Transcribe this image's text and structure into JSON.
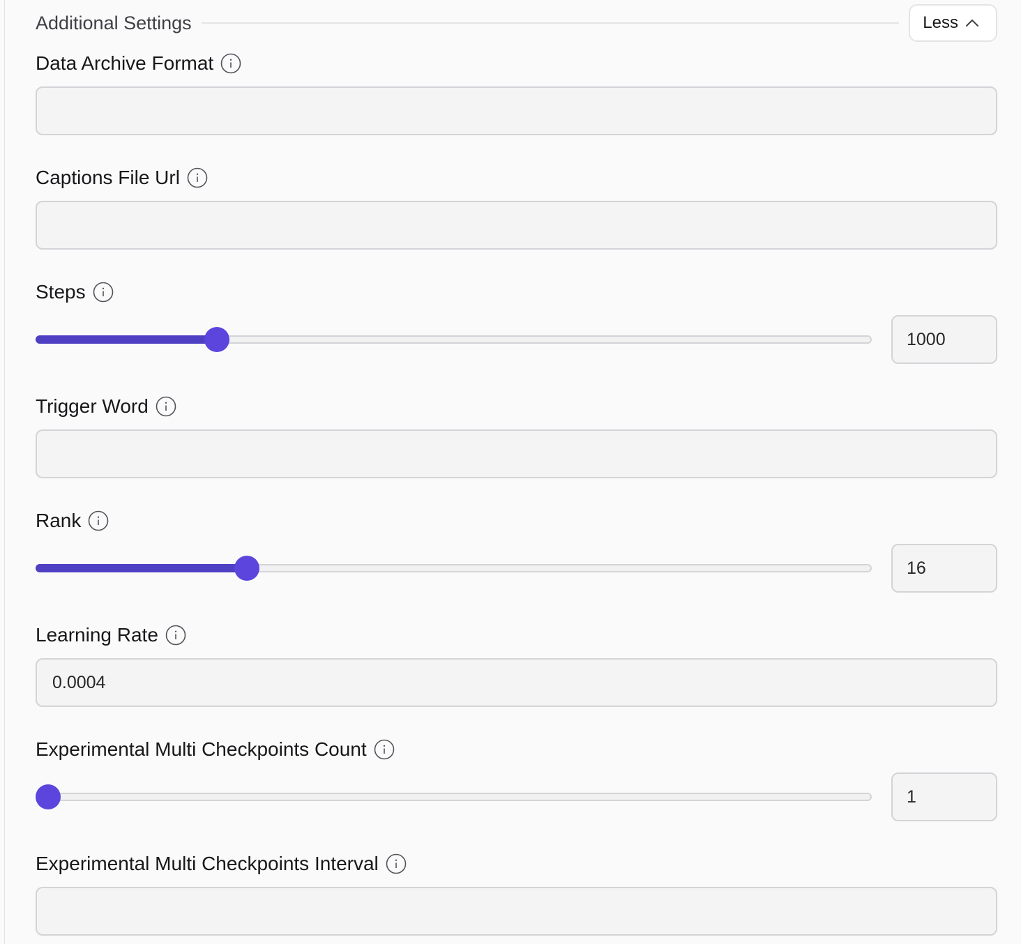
{
  "section": {
    "title": "Additional Settings",
    "toggle_label": "Less"
  },
  "fields": {
    "data_archive_format": {
      "label": "Data Archive Format",
      "value": ""
    },
    "captions_file_url": {
      "label": "Captions File Url",
      "value": ""
    },
    "steps": {
      "label": "Steps",
      "value": "1000",
      "slider_fraction": 0.208
    },
    "trigger_word": {
      "label": "Trigger Word",
      "value": ""
    },
    "rank": {
      "label": "Rank",
      "value": "16",
      "slider_fraction": 0.245
    },
    "learning_rate": {
      "label": "Learning Rate",
      "value": "0.0004"
    },
    "multi_checkpoints_count": {
      "label": "Experimental Multi Checkpoints Count",
      "value": "1",
      "slider_fraction": 0.0
    },
    "multi_checkpoints_interval": {
      "label": "Experimental Multi Checkpoints Interval",
      "value": ""
    }
  },
  "colors": {
    "accent": "#5b45dc",
    "slider_fill": "#4f3fc2",
    "input_bg": "#f4f4f4",
    "page_bg": "#fafafa"
  },
  "icons": {
    "info": "info-icon",
    "toggle": "chevron-up-icon"
  }
}
